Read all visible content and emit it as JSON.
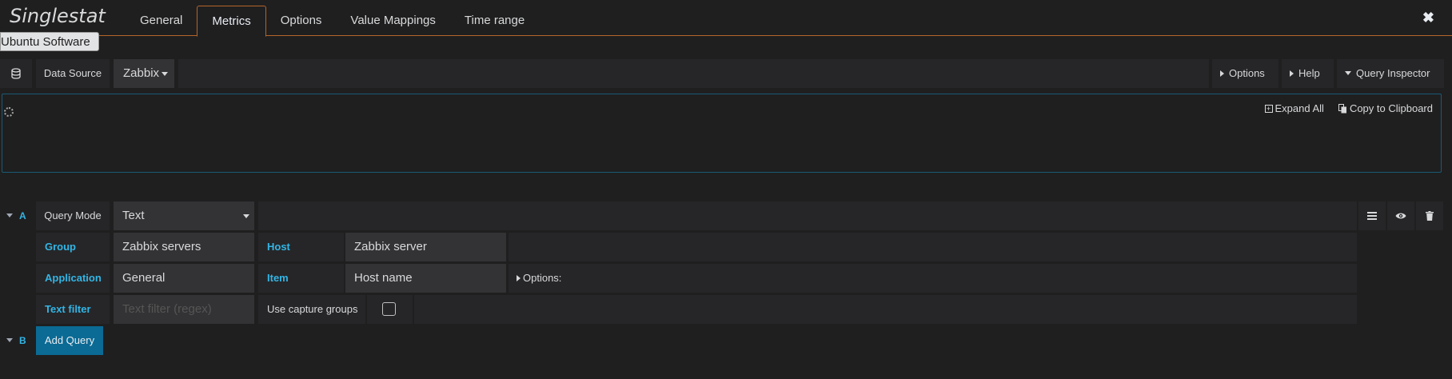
{
  "header": {
    "panel_title": "Singlestat",
    "tabs": [
      {
        "label": "General"
      },
      {
        "label": "Metrics"
      },
      {
        "label": "Options"
      },
      {
        "label": "Value Mappings"
      },
      {
        "label": "Time range"
      }
    ],
    "active_tab": "Metrics",
    "close_glyph": "✖"
  },
  "tooltip": "Ubuntu Software",
  "datasource_row": {
    "label": "Data Source",
    "selected": "Zabbix",
    "options_label": "Options",
    "help_label": "Help",
    "inspector_label": "Query Inspector"
  },
  "inspector": {
    "expand_all": "Expand All",
    "copy_clipboard": "Copy to Clipboard"
  },
  "query_a": {
    "letter": "A",
    "mode_label": "Query Mode",
    "mode_value": "Text",
    "group_label": "Group",
    "group_value": "Zabbix servers",
    "host_label": "Host",
    "host_value": "Zabbix server",
    "application_label": "Application",
    "application_value": "General",
    "item_label": "Item",
    "item_value": "Host name",
    "options_label": "Options:",
    "text_filter_label": "Text filter",
    "text_filter_placeholder": "Text filter (regex)",
    "capture_groups_label": "Use capture groups",
    "capture_groups_checked": false
  },
  "query_b": {
    "letter": "B",
    "add_query_label": "Add Query"
  },
  "colors": {
    "accent": "#b4642a",
    "label_blue": "#33b5e5",
    "primary_button": "#0b6b94",
    "background": "#1f1f20"
  }
}
